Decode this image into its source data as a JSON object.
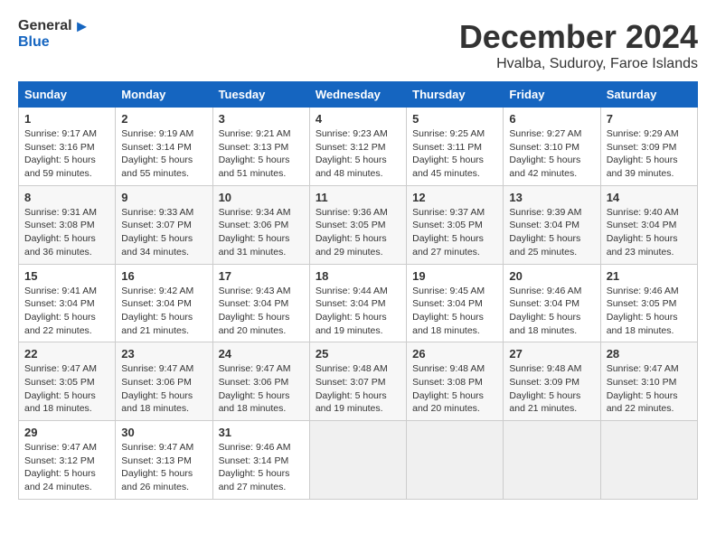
{
  "logo": {
    "general": "General",
    "blue": "Blue"
  },
  "title": {
    "month": "December 2024",
    "location": "Hvalba, Suduroy, Faroe Islands"
  },
  "weekdays": [
    "Sunday",
    "Monday",
    "Tuesday",
    "Wednesday",
    "Thursday",
    "Friday",
    "Saturday"
  ],
  "weeks": [
    [
      {
        "day": "1",
        "sunrise": "9:17 AM",
        "sunset": "3:16 PM",
        "daylight": "5 hours and 59 minutes."
      },
      {
        "day": "2",
        "sunrise": "9:19 AM",
        "sunset": "3:14 PM",
        "daylight": "5 hours and 55 minutes."
      },
      {
        "day": "3",
        "sunrise": "9:21 AM",
        "sunset": "3:13 PM",
        "daylight": "5 hours and 51 minutes."
      },
      {
        "day": "4",
        "sunrise": "9:23 AM",
        "sunset": "3:12 PM",
        "daylight": "5 hours and 48 minutes."
      },
      {
        "day": "5",
        "sunrise": "9:25 AM",
        "sunset": "3:11 PM",
        "daylight": "5 hours and 45 minutes."
      },
      {
        "day": "6",
        "sunrise": "9:27 AM",
        "sunset": "3:10 PM",
        "daylight": "5 hours and 42 minutes."
      },
      {
        "day": "7",
        "sunrise": "9:29 AM",
        "sunset": "3:09 PM",
        "daylight": "5 hours and 39 minutes."
      }
    ],
    [
      {
        "day": "8",
        "sunrise": "9:31 AM",
        "sunset": "3:08 PM",
        "daylight": "5 hours and 36 minutes."
      },
      {
        "day": "9",
        "sunrise": "9:33 AM",
        "sunset": "3:07 PM",
        "daylight": "5 hours and 34 minutes."
      },
      {
        "day": "10",
        "sunrise": "9:34 AM",
        "sunset": "3:06 PM",
        "daylight": "5 hours and 31 minutes."
      },
      {
        "day": "11",
        "sunrise": "9:36 AM",
        "sunset": "3:05 PM",
        "daylight": "5 hours and 29 minutes."
      },
      {
        "day": "12",
        "sunrise": "9:37 AM",
        "sunset": "3:05 PM",
        "daylight": "5 hours and 27 minutes."
      },
      {
        "day": "13",
        "sunrise": "9:39 AM",
        "sunset": "3:04 PM",
        "daylight": "5 hours and 25 minutes."
      },
      {
        "day": "14",
        "sunrise": "9:40 AM",
        "sunset": "3:04 PM",
        "daylight": "5 hours and 23 minutes."
      }
    ],
    [
      {
        "day": "15",
        "sunrise": "9:41 AM",
        "sunset": "3:04 PM",
        "daylight": "5 hours and 22 minutes."
      },
      {
        "day": "16",
        "sunrise": "9:42 AM",
        "sunset": "3:04 PM",
        "daylight": "5 hours and 21 minutes."
      },
      {
        "day": "17",
        "sunrise": "9:43 AM",
        "sunset": "3:04 PM",
        "daylight": "5 hours and 20 minutes."
      },
      {
        "day": "18",
        "sunrise": "9:44 AM",
        "sunset": "3:04 PM",
        "daylight": "5 hours and 19 minutes."
      },
      {
        "day": "19",
        "sunrise": "9:45 AM",
        "sunset": "3:04 PM",
        "daylight": "5 hours and 18 minutes."
      },
      {
        "day": "20",
        "sunrise": "9:46 AM",
        "sunset": "3:04 PM",
        "daylight": "5 hours and 18 minutes."
      },
      {
        "day": "21",
        "sunrise": "9:46 AM",
        "sunset": "3:05 PM",
        "daylight": "5 hours and 18 minutes."
      }
    ],
    [
      {
        "day": "22",
        "sunrise": "9:47 AM",
        "sunset": "3:05 PM",
        "daylight": "5 hours and 18 minutes."
      },
      {
        "day": "23",
        "sunrise": "9:47 AM",
        "sunset": "3:06 PM",
        "daylight": "5 hours and 18 minutes."
      },
      {
        "day": "24",
        "sunrise": "9:47 AM",
        "sunset": "3:06 PM",
        "daylight": "5 hours and 18 minutes."
      },
      {
        "day": "25",
        "sunrise": "9:48 AM",
        "sunset": "3:07 PM",
        "daylight": "5 hours and 19 minutes."
      },
      {
        "day": "26",
        "sunrise": "9:48 AM",
        "sunset": "3:08 PM",
        "daylight": "5 hours and 20 minutes."
      },
      {
        "day": "27",
        "sunrise": "9:48 AM",
        "sunset": "3:09 PM",
        "daylight": "5 hours and 21 minutes."
      },
      {
        "day": "28",
        "sunrise": "9:47 AM",
        "sunset": "3:10 PM",
        "daylight": "5 hours and 22 minutes."
      }
    ],
    [
      {
        "day": "29",
        "sunrise": "9:47 AM",
        "sunset": "3:12 PM",
        "daylight": "5 hours and 24 minutes."
      },
      {
        "day": "30",
        "sunrise": "9:47 AM",
        "sunset": "3:13 PM",
        "daylight": "5 hours and 26 minutes."
      },
      {
        "day": "31",
        "sunrise": "9:46 AM",
        "sunset": "3:14 PM",
        "daylight": "5 hours and 27 minutes."
      },
      null,
      null,
      null,
      null
    ]
  ]
}
